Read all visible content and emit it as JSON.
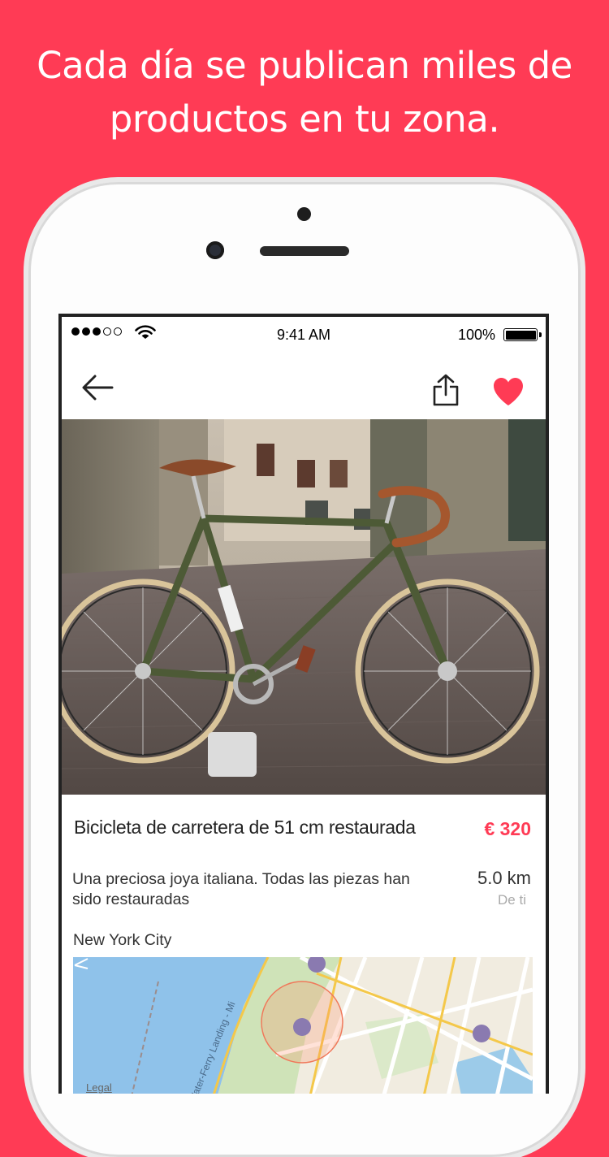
{
  "headline": {
    "line1": "Cada día se publican miles de",
    "line2": "productos en tu zona."
  },
  "status_bar": {
    "time": "9:41 AM",
    "battery": "100%"
  },
  "colors": {
    "brand": "#FF3B55",
    "heart": "#FF3B55"
  },
  "navbar": {
    "back_icon": "arrow-left-icon",
    "share_icon": "share-icon",
    "favorite_icon": "heart-icon"
  },
  "product": {
    "title": "Bicicleta de carretera de 51 cm restaurada",
    "price": "€ 320",
    "description": "Una preciosa joya italiana. Todas las piezas han sido restauradas",
    "distance": "5.0 km",
    "distance_label": "De ti",
    "city": "New York City"
  },
  "map": {
    "legal": "Legal",
    "street_label": "Water-Ferry Landing - Mi"
  }
}
